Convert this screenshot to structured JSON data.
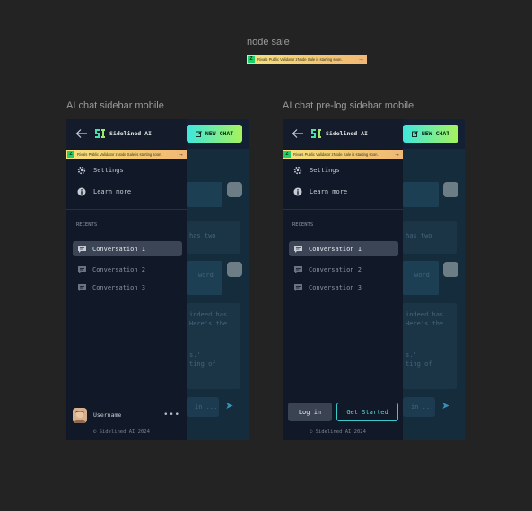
{
  "top_section": {
    "label": "node sale"
  },
  "banner": {
    "text": "Rivals Public Validator zNode Sale is starting soon.",
    "arrow": "→"
  },
  "mockups": [
    {
      "label": "AI chat sidebar mobile",
      "brand": "Sidelined AI",
      "new_chat": "NEW CHAT",
      "menu": {
        "settings": "Settings",
        "learn_more": "Learn more"
      },
      "recents_label": "RECENTS",
      "conversations": [
        "Conversation 1",
        "Conversation 2",
        "Conversation 3"
      ],
      "username": "Username",
      "more": "•••",
      "copyright": "© Sidelined AI 2024",
      "bg": {
        "t1": "has two",
        "t2": "word",
        "t3": "indeed has\nHere's the",
        "t4": "s.'\nting of",
        "input": "in ..."
      }
    },
    {
      "label": "AI chat pre-log sidebar mobile",
      "brand": "Sidelined AI",
      "new_chat": "NEW CHAT",
      "menu": {
        "settings": "Settings",
        "learn_more": "Learn more"
      },
      "recents_label": "RECENTS",
      "conversations": [
        "Conversation 1",
        "Conversation 2",
        "Conversation 3"
      ],
      "login": "Log in",
      "get_started": "Get Started",
      "copyright": "© Sidelined AI 2024",
      "bg": {
        "t1": "has two",
        "t2": "word",
        "t3": "indeed has\nHere's the",
        "t4": "s.'\nting of",
        "input": "in ..."
      }
    }
  ],
  "colors": {
    "accent_start": "#3ee6e0",
    "accent_end": "#a7f35a",
    "sidebar_bg": "#111827",
    "active_item": "#3b4556"
  },
  "icons": [
    "back-arrow-icon",
    "logo-icon",
    "edit-icon",
    "gear-icon",
    "info-icon",
    "chat-bubble-icon",
    "send-icon",
    "more-icon"
  ]
}
